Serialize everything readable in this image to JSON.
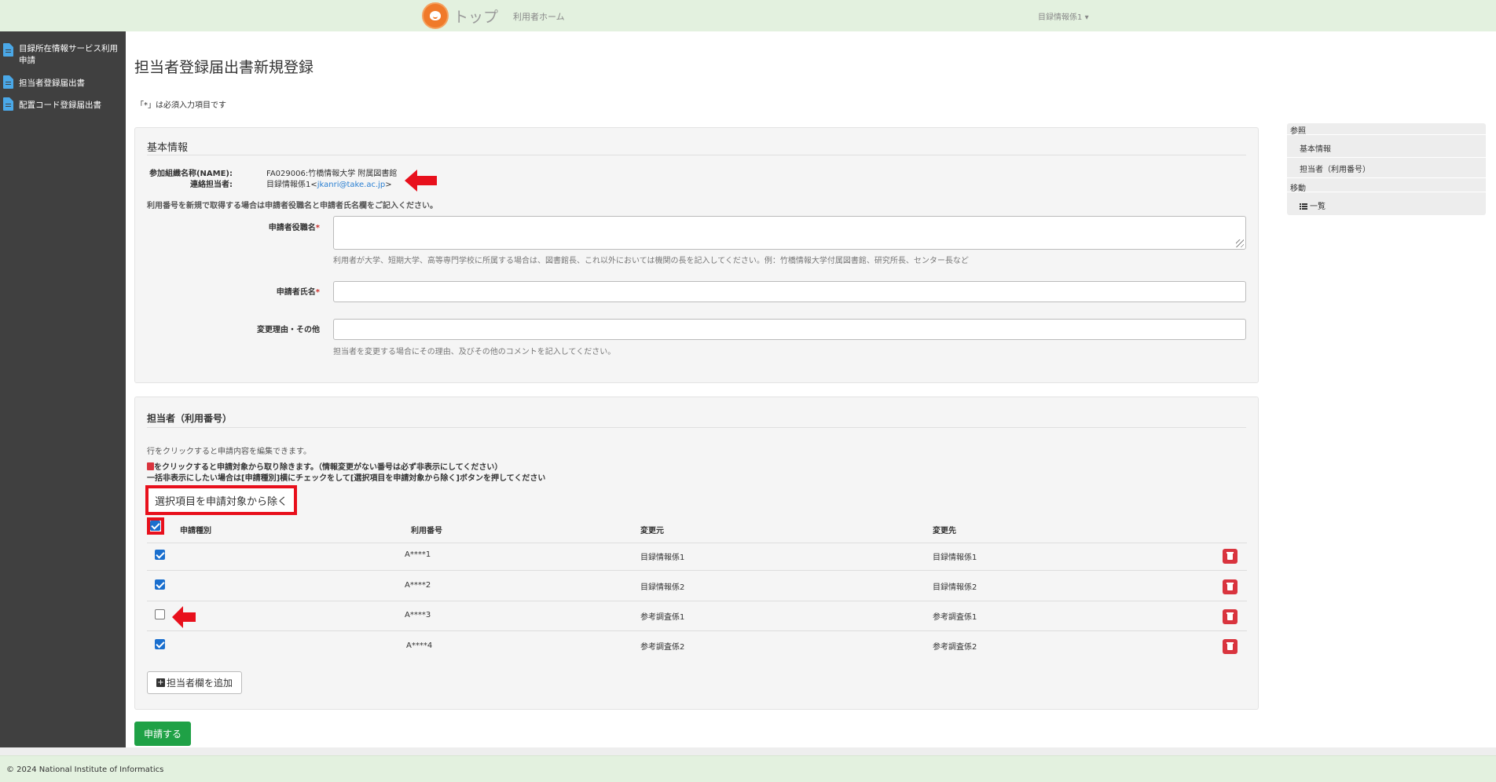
{
  "header": {
    "brand": "トップ",
    "nav_link": "利用者ホーム",
    "user_menu": "目録情報係1"
  },
  "sidebar": {
    "items": [
      {
        "label": "目録所在情報サービス利用申請"
      },
      {
        "label": "担当者登録届出書"
      },
      {
        "label": "配置コード登録届出書"
      }
    ]
  },
  "page": {
    "title": "担当者登録届出書新規登録",
    "required_note": "「*」は必須入力項目です"
  },
  "basic_info": {
    "legend": "基本情報",
    "org_label": "参加組織名称(NAME):",
    "org_value": "FA029006:竹橋情報大学 附属図書館",
    "contact_label": "連絡担当者:",
    "contact_name": "目録情報係1<",
    "contact_email": "jkanri@take.ac.jp",
    "contact_close": ">",
    "instruction": "利用番号を新規で取得する場合は申請者役職名と申請者氏名欄をご記入ください。",
    "fields": {
      "title_label": "申請者役職名",
      "title_help": "利用者が大学、短期大学、高等専門学校に所属する場合は、図書館長、これ以外においては機関の長を記入してください。例：竹橋情報大学付属図書館、研究所長、センター長など",
      "name_label": "申請者氏名",
      "reason_label": "変更理由・その他",
      "reason_help": "担当者を変更する場合にその理由、及びその他のコメントを記入してください。",
      "required_mark": "*"
    }
  },
  "staff": {
    "legend": "担当者（利用番号）",
    "instruction1": "行をクリックすると申請内容を編集できます。",
    "instruction2": "をクリックすると申請対象から取り除きます。（情報変更がない番号は必ず非表示にしてください）",
    "instruction3": "一括非表示にしたい場合は[申請種別]横にチェックをして[選択項目を申請対象から除く]ボタンを押してください",
    "remove_selected_button": "選択項目を申請対象から除く",
    "columns": [
      "申請種別",
      "利用番号",
      "変更元",
      "変更先"
    ],
    "rows": [
      {
        "checked": true,
        "number": "A****1",
        "from": "目録情報係1",
        "to": "目録情報係1"
      },
      {
        "checked": true,
        "number": "A****2",
        "from": "目録情報係2",
        "to": "目録情報係2"
      },
      {
        "checked": false,
        "number": "A****3",
        "from": "参考調査係1",
        "to": "参考調査係1"
      },
      {
        "checked": true,
        "number": "A****4",
        "from": "参考調査係2",
        "to": "参考調査係2"
      }
    ],
    "add_button": "担当者欄を追加"
  },
  "submit_button": "申請する",
  "right_nav": {
    "reference_heading": "参照",
    "reference_items": [
      "基本情報",
      "担当者（利用番号）"
    ],
    "move_heading": "移動",
    "move_items": [
      "一覧"
    ]
  },
  "footer": {
    "copyright": "© 2024 National Institute of Informatics"
  },
  "colors": {
    "topbar": "#e3f1df",
    "sidebar": "#404040",
    "accent_red": "#e8101c",
    "submit_green": "#1fa146",
    "link_blue": "#2a7fd1"
  }
}
